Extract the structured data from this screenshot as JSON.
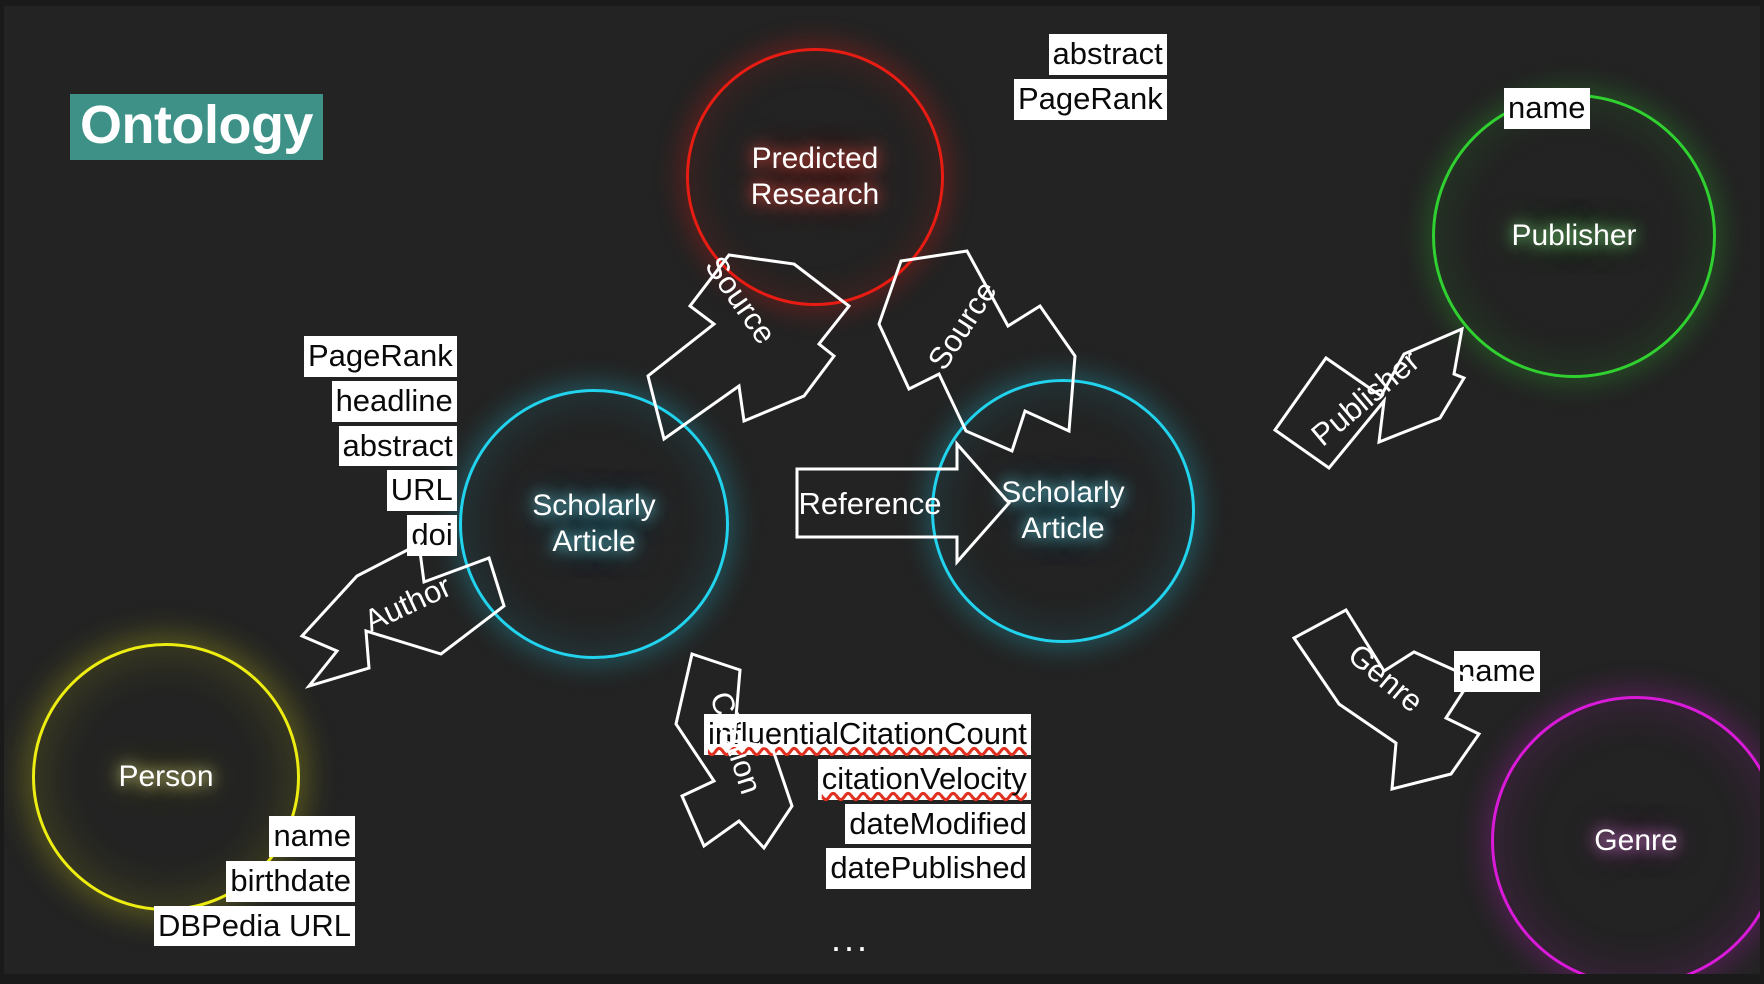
{
  "page": {
    "title": "Ontology",
    "background_color": "#232323",
    "title_highlight_color": "#3d9186"
  },
  "nodes": [
    {
      "id": "predicted-research",
      "label": "Predicted\nResearch",
      "color": "#e81c13"
    },
    {
      "id": "scholarly-article-left",
      "label": "Scholarly\nArticle",
      "color": "#22d3ee"
    },
    {
      "id": "scholarly-article-right",
      "label": "Scholarly\nArticle",
      "color": "#22d3ee"
    },
    {
      "id": "publisher",
      "label": "Publisher",
      "color": "#2fd02f"
    },
    {
      "id": "person",
      "label": "Person",
      "color": "#eded12"
    },
    {
      "id": "genre",
      "label": "Genre",
      "color": "#d91ad9"
    }
  ],
  "edges": [
    {
      "id": "source-left",
      "label": "Source",
      "from": "predicted-research",
      "to": "scholarly-article-left"
    },
    {
      "id": "source-right",
      "label": "Source",
      "from": "predicted-research",
      "to": "scholarly-article-right"
    },
    {
      "id": "reference",
      "label": "Reference",
      "from": "scholarly-article-left",
      "to": "scholarly-article-right"
    },
    {
      "id": "publisher-edge",
      "label": "Publisher",
      "from": "scholarly-article-right",
      "to": "publisher"
    },
    {
      "id": "author",
      "label": "Author",
      "from": "scholarly-article-left",
      "to": "person"
    },
    {
      "id": "citation",
      "label": "Citation",
      "from": "scholarly-article-left",
      "to": "ellipsis"
    },
    {
      "id": "genre-edge",
      "label": "Genre",
      "from": "scholarly-article-right",
      "to": "genre"
    }
  ],
  "property_groups": {
    "predicted_research": {
      "owner": "predicted-research",
      "items": [
        {
          "text": "abstract",
          "misspelled": false
        },
        {
          "text": "PageRank",
          "misspelled": false
        }
      ]
    },
    "scholarly_article_left": {
      "owner": "scholarly-article-left",
      "items": [
        {
          "text": "PageRank",
          "misspelled": false
        },
        {
          "text": "headline",
          "misspelled": false
        },
        {
          "text": "abstract",
          "misspelled": false
        },
        {
          "text": "URL",
          "misspelled": false
        },
        {
          "text": "doi",
          "misspelled": false
        }
      ]
    },
    "scholarly_article_right": {
      "owner": "scholarly-article-right",
      "items": [
        {
          "text": "influentialCitationCount",
          "misspelled": true
        },
        {
          "text": "citationVelocity",
          "misspelled": true
        },
        {
          "text": "dateModified",
          "misspelled": false
        },
        {
          "text": "datePublished",
          "misspelled": false
        }
      ]
    },
    "publisher": {
      "owner": "publisher",
      "items": [
        {
          "text": "name",
          "misspelled": false
        }
      ]
    },
    "person": {
      "owner": "person",
      "items": [
        {
          "text": "name",
          "misspelled": false
        },
        {
          "text": "birthdate",
          "misspelled": false
        },
        {
          "text": "DBPedia URL",
          "misspelled": false
        }
      ]
    },
    "genre": {
      "owner": "genre",
      "items": [
        {
          "text": "name",
          "misspelled": false
        }
      ]
    }
  },
  "ellipsis": "..."
}
